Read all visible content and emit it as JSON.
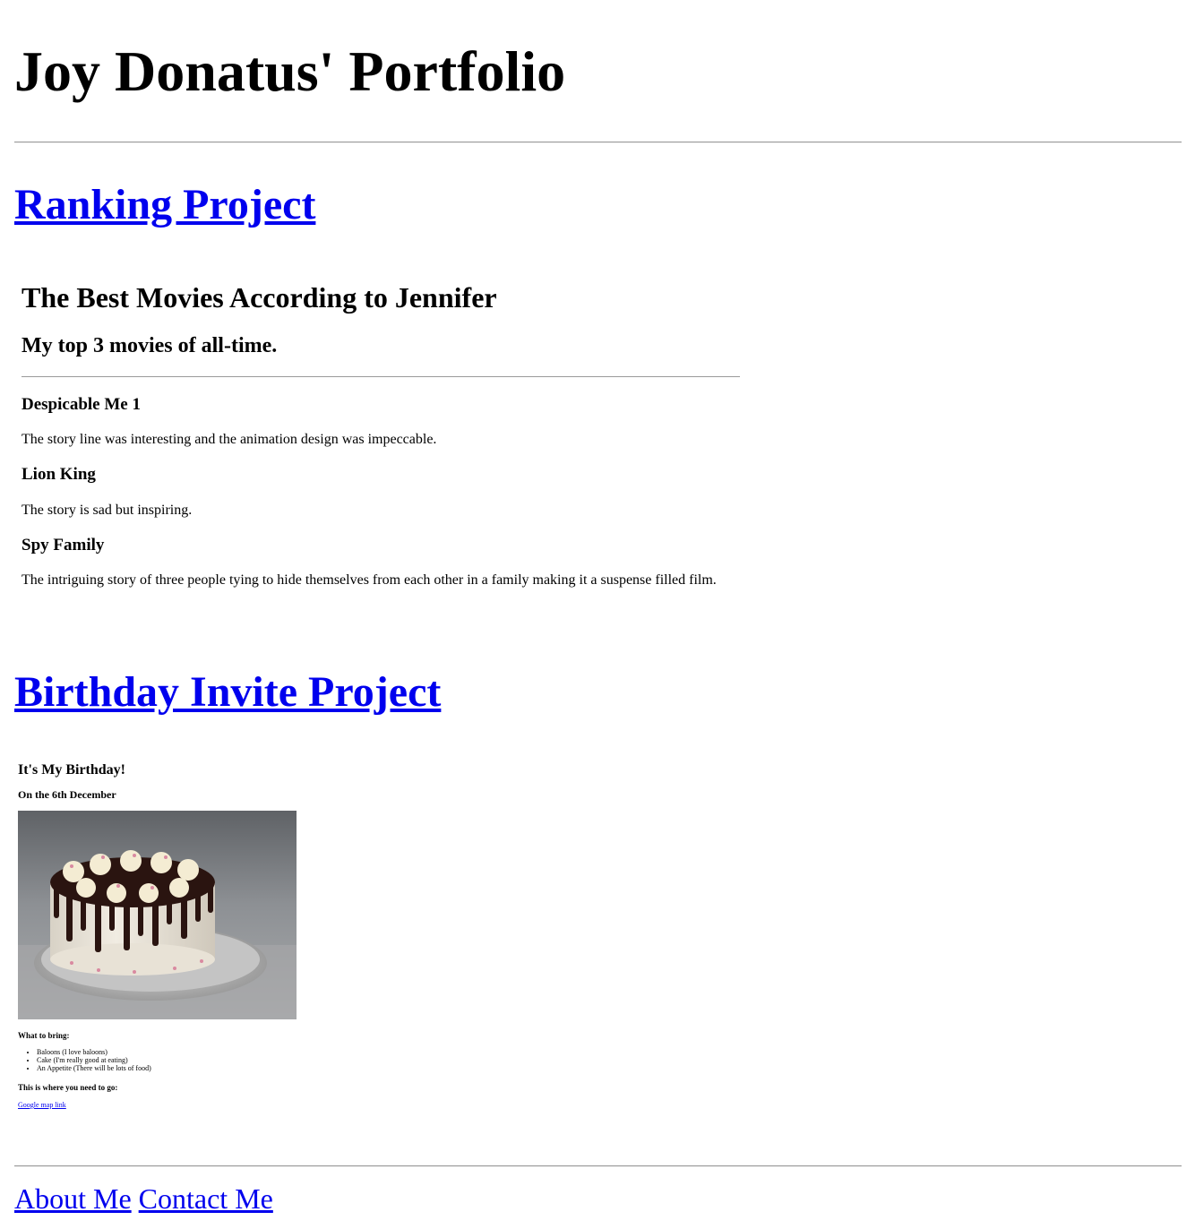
{
  "header": {
    "title": "Joy Donatus' Portfolio"
  },
  "projects": [
    {
      "link_label": "Ranking Project"
    },
    {
      "link_label": "Birthday Invite Project"
    }
  ],
  "ranking": {
    "title": "The Best Movies According to Jennifer",
    "subtitle": "My top 3 movies of all-time.",
    "movies": [
      {
        "name": "Despicable Me 1",
        "description": "The story line was interesting and the animation design was impeccable."
      },
      {
        "name": "Lion King",
        "description": "The story is sad but inspiring."
      },
      {
        "name": "Spy Family",
        "description": "The intriguing story of three people tying to hide themselves from each other in a family making it a suspense filled film."
      }
    ]
  },
  "birthday": {
    "title": "It's My Birthday!",
    "date": "On the 6th December",
    "image_subject": "cake-photo",
    "bring_heading": "What to bring:",
    "bring_items": [
      "Baloons (I love baloons)",
      "Cake (I'm really good at eating)",
      "An Appetite (There will be lots of food)"
    ],
    "where_heading": "This is where you need to go:",
    "map_link": "Google map link"
  },
  "footer": {
    "about_link": "About Me",
    "contact_link": "Contact Me"
  },
  "colors": {
    "link": "#0000ee",
    "rule": "#9a9a9a"
  }
}
